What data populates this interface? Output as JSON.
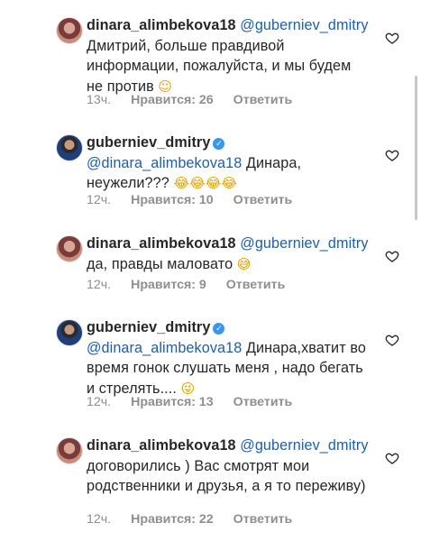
{
  "comments": [
    {
      "username": "dinara_alimbekova18",
      "verified": false,
      "mention": "@guberniev_dmitry",
      "text": "Дмитрий, больше правдивой информации, пожалуйста, и мы будем не против",
      "emoji": "☺",
      "time": "13ч.",
      "likes": "Нравится: 26",
      "reply": "Ответить"
    },
    {
      "username": "guberniev_dmitry",
      "verified": true,
      "mention": "@dinara_alimbekova18",
      "text": "Динара, неужели???",
      "emoji": "😂😂😂😂",
      "time": "12ч.",
      "likes": "Нравится: 10",
      "reply": "Ответить"
    },
    {
      "username": "dinara_alimbekova18",
      "verified": false,
      "mention": "@guberniev_dmitry",
      "text": "да, правды маловато",
      "emoji": "😅",
      "time": "12ч.",
      "likes": "Нравится: 9",
      "reply": "Ответить"
    },
    {
      "username": "guberniev_dmitry",
      "verified": true,
      "mention": "@dinara_alimbekova18",
      "text": "Динара,хватит во время гонок слушать меня , надо бегать и стрелять....",
      "emoji": "😜",
      "time": "12ч.",
      "likes": "Нравится: 13",
      "reply": "Ответить"
    },
    {
      "username": "dinara_alimbekova18",
      "verified": false,
      "mention": "@guberniev_dmitry",
      "text": "договорились ) Вас смотрят мои родственники и друзья, а я то переживу)",
      "emoji": "",
      "time": "12ч.",
      "likes": "Нравится: 22",
      "reply": "Ответить"
    }
  ],
  "colors": {
    "text": "#262626",
    "mention": "#1f5fa8",
    "meta": "#8e8e8e",
    "verified": "#3897f0"
  },
  "icons": {
    "like": "heart-outline-icon",
    "verified": "verified-badge-icon"
  }
}
